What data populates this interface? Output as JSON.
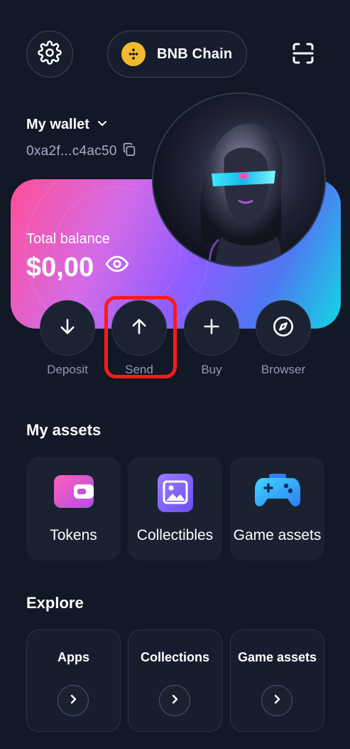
{
  "header": {
    "chain_name": "BNB Chain",
    "settings_icon": "gear-icon",
    "scan_icon": "scan-icon"
  },
  "wallet": {
    "name": "My wallet",
    "address": "0xa2f...c4ac50"
  },
  "balance": {
    "label": "Total balance",
    "amount": "$0,00"
  },
  "actions": [
    {
      "label": "Deposit",
      "icon": "arrow-down-icon"
    },
    {
      "label": "Send",
      "icon": "arrow-up-icon"
    },
    {
      "label": "Buy",
      "icon": "plus-icon"
    },
    {
      "label": "Browser",
      "icon": "compass-icon"
    }
  ],
  "my_assets": {
    "title": "My assets",
    "items": [
      {
        "label": "Tokens",
        "icon": "wallet-icon"
      },
      {
        "label": "Collectibles",
        "icon": "image-icon"
      },
      {
        "label": "Game assets",
        "icon": "gamepad-icon"
      }
    ]
  },
  "explore": {
    "title": "Explore",
    "items": [
      {
        "label": "Apps"
      },
      {
        "label": "Collections"
      },
      {
        "label": "Game assets"
      }
    ]
  },
  "colors": {
    "background": "#121826",
    "highlight": "#ff1a1a",
    "bnb": "#f3ba2f"
  }
}
